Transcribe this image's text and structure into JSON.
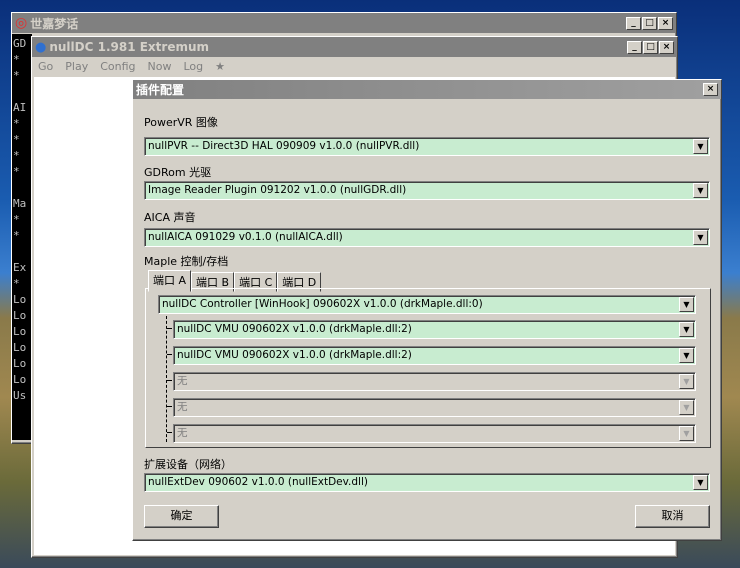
{
  "outer_window": {
    "title": "世嘉梦话",
    "console_lines": [
      "GD",
      "*",
      "*",
      "",
      "AI",
      "*",
      "*",
      "*",
      "*",
      "",
      "Ma",
      "*",
      "*",
      "",
      "Ex",
      "*",
      "Lo",
      "Lo",
      "Lo",
      "Lo",
      "Lo",
      "Lo",
      "Us"
    ]
  },
  "main_window": {
    "title": "nullDC 1.981 Extremum",
    "menu": [
      "Go",
      "Play",
      "Config",
      "Now",
      "Log",
      "★"
    ]
  },
  "dialog": {
    "title": "插件配置",
    "pvr_label": "PowerVR 图像",
    "pvr_value": "nullPVR -- Direct3D HAL 090909 v1.0.0 (nullPVR.dll)",
    "gdr_label": "GDRom 光驱",
    "gdr_value": "Image Reader Plugin 091202 v1.0.0 (nullGDR.dll)",
    "aica_label": "AICA 声音",
    "aica_value": "nullAICA 091029 v0.1.0 (nullAICA.dll)",
    "maple_label": "Maple 控制/存档",
    "tabs": [
      "端口 A",
      "端口 B",
      "端口 C",
      "端口 D"
    ],
    "controller": "nullDC Controller [WinHook] 090602X v1.0.0 (drkMaple.dll:0)",
    "subs": [
      "nullDC VMU 090602X v1.0.0 (drkMaple.dll:2)",
      "nullDC VMU 090602X v1.0.0 (drkMaple.dll:2)",
      "无",
      "无",
      "无"
    ],
    "ext_label": "扩展设备（网络）",
    "ext_value": "nullExtDev 090602 v1.0.0 (nullExtDev.dll)",
    "ok": "确定",
    "cancel": "取消"
  }
}
